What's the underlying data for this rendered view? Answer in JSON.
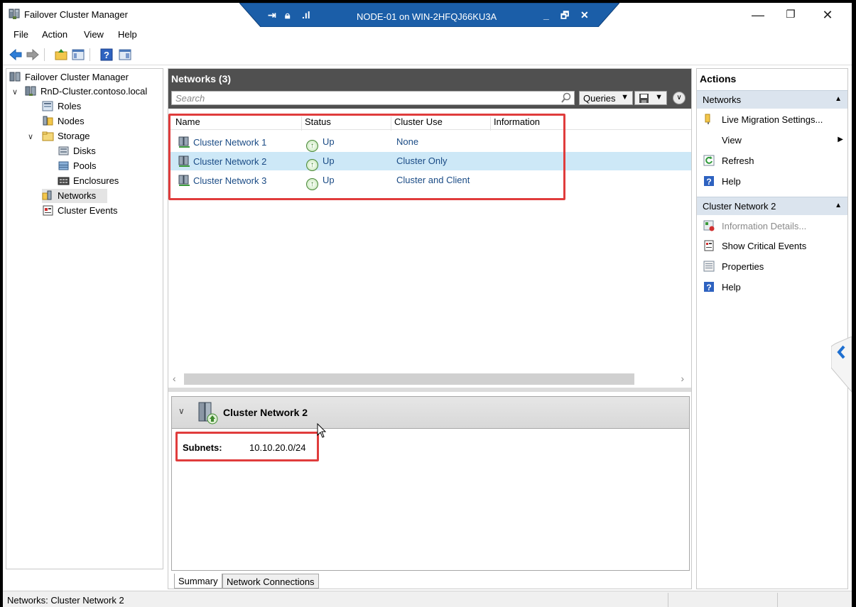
{
  "window": {
    "title": "Failover Cluster Manager",
    "min": "—",
    "restore": "❐",
    "close": "✕"
  },
  "rdp": {
    "title": "NODE-01 on WIN-2HFQJ66KU3A",
    "min": "_",
    "restore": "🗗",
    "close": "✕"
  },
  "menu": [
    "File",
    "Action",
    "View",
    "Help"
  ],
  "tree": {
    "root": "Failover Cluster Manager",
    "cluster": "RnD-Cluster.contoso.local",
    "roles": "Roles",
    "nodes": "Nodes",
    "storage": "Storage",
    "disks": "Disks",
    "pools": "Pools",
    "enclosures": "Enclosures",
    "networks": "Networks",
    "events": "Cluster Events"
  },
  "center": {
    "header": "Networks (3)",
    "search_placeholder": "Search",
    "queries_label": "Queries",
    "columns": [
      "Name",
      "Status",
      "Cluster Use",
      "Information"
    ],
    "rows": [
      {
        "name": "Cluster Network 1",
        "status": "Up",
        "use": "None",
        "info": ""
      },
      {
        "name": "Cluster Network 2",
        "status": "Up",
        "use": "Cluster Only",
        "info": ""
      },
      {
        "name": "Cluster Network 3",
        "status": "Up",
        "use": "Cluster and Client",
        "info": ""
      }
    ],
    "selected_row": 1
  },
  "detail": {
    "title": "Cluster Network 2",
    "subnets_label": "Subnets:",
    "subnets_value": "10.10.20.0/24",
    "tabs": [
      "Summary",
      "Network Connections"
    ]
  },
  "actions": {
    "title": "Actions",
    "section1": "Networks",
    "section1_items": [
      "Live Migration Settings...",
      "View",
      "Refresh",
      "Help"
    ],
    "section2": "Cluster Network 2",
    "section2_items": [
      "Information Details...",
      "Show Critical Events",
      "Properties",
      "Help"
    ]
  },
  "status": {
    "text": "Networks:  Cluster Network 2"
  },
  "colors": {
    "accent": "#1e6fd0",
    "selection": "#cde8f7",
    "highlight": "#e03c3c",
    "header": "#505050"
  }
}
